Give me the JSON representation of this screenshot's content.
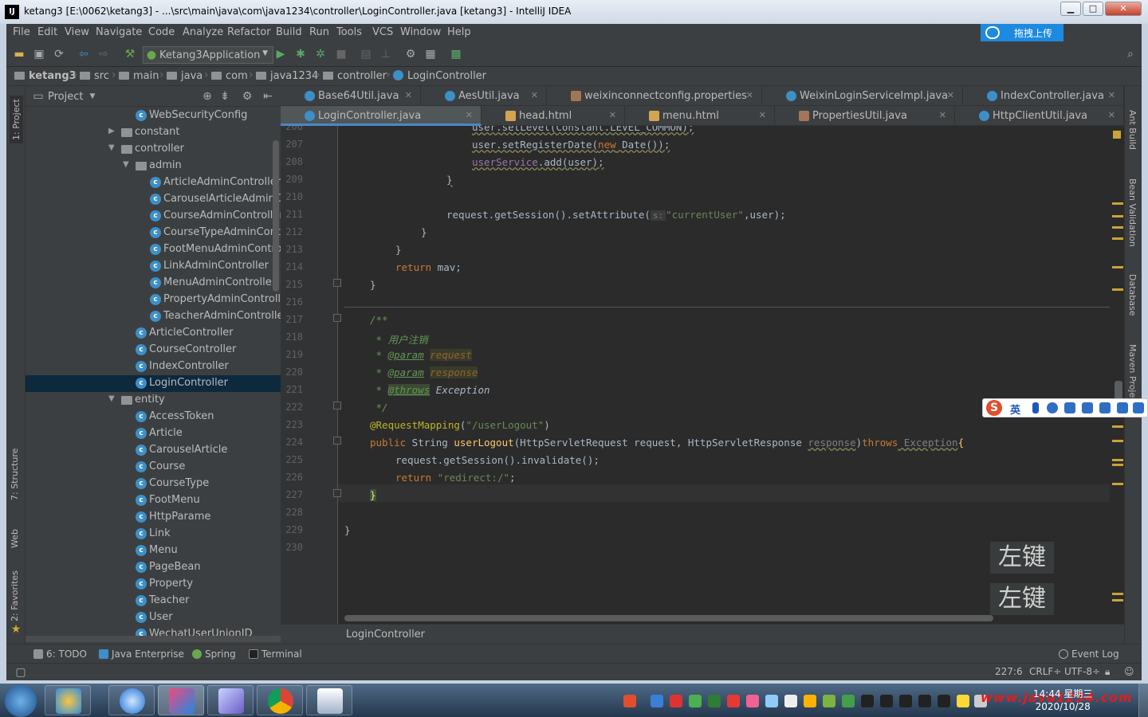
{
  "window": {
    "title": "ketang3 [E:\\0062\\ketang3] - ...\\src\\main\\java\\com\\java1234\\controller\\LoginController.java [ketang3] - IntelliJ IDEA",
    "minimize": "▁",
    "maximize": "□",
    "close": "✕"
  },
  "menu": [
    "File",
    "Edit",
    "View",
    "Navigate",
    "Code",
    "Analyze",
    "Refactor",
    "Build",
    "Run",
    "Tools",
    "VCS",
    "Window",
    "Help"
  ],
  "upload_button": "拖拽上传",
  "run_config": "Ketang3Application",
  "breadcrumb": [
    "ketang3",
    "src",
    "main",
    "java",
    "com",
    "java1234",
    "controller",
    "LoginController"
  ],
  "left_stripe": {
    "project": "1: Project",
    "structure": "7: Structure",
    "web": "Web",
    "favorites": "2: Favorites"
  },
  "right_stripe": {
    "ant": "Ant Build",
    "bean": "Bean Validation",
    "database": "Database",
    "maven": "Maven Projects"
  },
  "project_panel": {
    "title": "Project",
    "tree": [
      {
        "label": "WebSecurityConfig",
        "kind": "class",
        "depth": 2
      },
      {
        "label": "constant",
        "kind": "folder",
        "depth": 1,
        "arrow": "▶"
      },
      {
        "label": "controller",
        "kind": "folder",
        "depth": 1,
        "arrow": "▼"
      },
      {
        "label": "admin",
        "kind": "folder",
        "depth": 2,
        "arrow": "▼"
      },
      {
        "label": "ArticleAdminController",
        "kind": "class",
        "depth": 3
      },
      {
        "label": "CarouselArticleAdminController",
        "kind": "class",
        "depth": 3
      },
      {
        "label": "CourseAdminController",
        "kind": "class",
        "depth": 3
      },
      {
        "label": "CourseTypeAdminController",
        "kind": "class",
        "depth": 3
      },
      {
        "label": "FootMenuAdminController",
        "kind": "class",
        "depth": 3
      },
      {
        "label": "LinkAdminController",
        "kind": "class",
        "depth": 3
      },
      {
        "label": "MenuAdminController",
        "kind": "class",
        "depth": 3
      },
      {
        "label": "PropertyAdminController",
        "kind": "class",
        "depth": 3
      },
      {
        "label": "TeacherAdminController",
        "kind": "class",
        "depth": 3
      },
      {
        "label": "ArticleController",
        "kind": "class",
        "depth": 2
      },
      {
        "label": "CourseController",
        "kind": "class",
        "depth": 2
      },
      {
        "label": "IndexController",
        "kind": "class",
        "depth": 2
      },
      {
        "label": "LoginController",
        "kind": "class",
        "depth": 2,
        "selected": true
      },
      {
        "label": "entity",
        "kind": "folder",
        "depth": 1,
        "arrow": "▼"
      },
      {
        "label": "AccessToken",
        "kind": "class",
        "depth": 2
      },
      {
        "label": "Article",
        "kind": "class",
        "depth": 2
      },
      {
        "label": "CarouselArticle",
        "kind": "class",
        "depth": 2
      },
      {
        "label": "Course",
        "kind": "class",
        "depth": 2
      },
      {
        "label": "CourseType",
        "kind": "class",
        "depth": 2
      },
      {
        "label": "FootMenu",
        "kind": "class",
        "depth": 2
      },
      {
        "label": "HttpParame",
        "kind": "class",
        "depth": 2
      },
      {
        "label": "Link",
        "kind": "class",
        "depth": 2
      },
      {
        "label": "Menu",
        "kind": "class",
        "depth": 2
      },
      {
        "label": "PageBean",
        "kind": "class",
        "depth": 2
      },
      {
        "label": "Property",
        "kind": "class",
        "depth": 2
      },
      {
        "label": "Teacher",
        "kind": "class",
        "depth": 2
      },
      {
        "label": "User",
        "kind": "class",
        "depth": 2
      },
      {
        "label": "WechatUserUnionID",
        "kind": "class",
        "depth": 2
      }
    ]
  },
  "tabs_row1": [
    {
      "label": "Base64Util.java",
      "kind": "class"
    },
    {
      "label": "AesUtil.java",
      "kind": "class"
    },
    {
      "label": "weixinconnectconfig.properties",
      "kind": "prop"
    },
    {
      "label": "WeixinLoginServiceImpl.java",
      "kind": "class"
    },
    {
      "label": "IndexController.java",
      "kind": "class"
    }
  ],
  "tabs_row2": [
    {
      "label": "LoginController.java",
      "kind": "class",
      "active": true
    },
    {
      "label": "head.html",
      "kind": "html"
    },
    {
      "label": "menu.html",
      "kind": "html"
    },
    {
      "label": "PropertiesUtil.java",
      "kind": "prop"
    },
    {
      "label": "HttpClientUtil.java",
      "kind": "class"
    }
  ],
  "tab_close": "✕",
  "editor": {
    "line_numbers": [
      "206",
      "207",
      "208",
      "209",
      "210",
      "211",
      "212",
      "213",
      "214",
      "215",
      "216",
      "217",
      "218",
      "219",
      "220",
      "221",
      "222",
      "223",
      "224",
      "225",
      "226",
      "227",
      "228",
      "229",
      "230"
    ],
    "code": {
      "l206": "user.setLevel(Constant.LEVEL_COMMON);",
      "l207a": "user.setRegisterDate(",
      "l207b": "new",
      "l207c": " Date());",
      "l208a": "userService",
      "l208b": ".add(user);",
      "l209": "}",
      "l211a": "request.getSession().setAttribute(",
      "l211hint": "s:",
      "l211b": "\"currentUser\"",
      "l211c": ",user);",
      "l212": "}",
      "l213": "}",
      "l214a": "return",
      "l214b": " mav;",
      "l215": "}",
      "l217": "/**",
      "l218": " * 用户注销",
      "l219a": " * ",
      "l219b": "@param",
      "l219c": "request",
      "l220a": " * ",
      "l220b": "@param",
      "l220c": "response",
      "l221a": " * ",
      "l221b": "@throws",
      "l221c": " Exception",
      "l222": " */",
      "l223a": "@RequestMapping",
      "l223b": "(",
      "l223c": "\"/userLogout\"",
      "l223d": ")",
      "l224a": "public",
      "l224b": " String ",
      "l224c": "userLogout",
      "l224d": "(HttpServletRequest request, HttpServletResponse ",
      "l224e": "response",
      "l224f": ")",
      "l224g": "throws",
      "l224h": " Exception",
      "l224i": "{",
      "l225": "request.getSession().invalidate();",
      "l226a": "return",
      "l226b": "\"redirect:/\"",
      "l226c": ";",
      "l227": "}",
      "l229": "}"
    },
    "overlay_1": "左键",
    "overlay_2": "左键"
  },
  "editor_footer": "LoginController",
  "tool_windows": [
    "6: TODO",
    "Java Enterprise",
    "Spring",
    "Terminal"
  ],
  "event_log": "Event Log",
  "status": {
    "position": "227:6",
    "line_sep": "CRLF÷",
    "encoding": "UTF-8÷"
  },
  "ime": {
    "mode": "英"
  },
  "taskbar": {
    "time": "14:44",
    "weekday": "星期三",
    "date": "2020/10/28",
    "watermark": "www.java1234.com"
  },
  "colors": {
    "keyword": "#cc7832",
    "string": "#6a8759",
    "comment": "#629755",
    "annotation": "#bbb529",
    "function": "#ffc66d",
    "field": "#9876aa",
    "selection": "#0d293e",
    "accent": "#4a88c7"
  }
}
